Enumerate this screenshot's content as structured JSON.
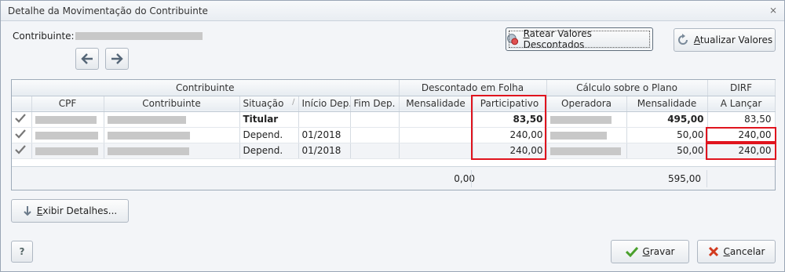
{
  "window": {
    "title": "Detalhe da Movimentação do Contribuinte",
    "close_glyph": "⨯"
  },
  "header": {
    "contribuinte_label": "Contribuinte:"
  },
  "toolbar": {
    "ratear_label": "Ratear Valores Descontados",
    "ratear_underline": "R",
    "atualizar_label": "Atualizar Valores",
    "atualizar_underline": "A"
  },
  "grid": {
    "groups": [
      {
        "label": "Contribuinte"
      },
      {
        "label": "Descontado em Folha"
      },
      {
        "label": "Cálculo sobre o Plano"
      },
      {
        "label": "DIRF"
      }
    ],
    "columns": [
      "CPF",
      "Contribuinte",
      "Situação",
      "Início Dep.",
      "Fim Dep.",
      "Mensalidade",
      "Participativo",
      "Operadora",
      "Mensalidade",
      "A Lançar"
    ],
    "rows": [
      {
        "situacao": "Titular",
        "inicio": "",
        "fim": "",
        "mens_desc": "",
        "participativo": "83,50",
        "mens_plano": "495,00",
        "a_lancar": "83,50"
      },
      {
        "situacao": "Depend.",
        "inicio": "01/2018",
        "fim": "",
        "mens_desc": "",
        "participativo": "240,00",
        "mens_plano": "50,00",
        "a_lancar": "240,00"
      },
      {
        "situacao": "Depend.",
        "inicio": "01/2018",
        "fim": "",
        "mens_desc": "",
        "participativo": "240,00",
        "mens_plano": "50,00",
        "a_lancar": "240,00"
      }
    ],
    "totals": {
      "desc_mensalidade": "0,00",
      "plano_mensalidade": "595,00"
    }
  },
  "actions": {
    "exibir_label": "Exibir Detalhes...",
    "exibir_underline": "E",
    "gravar_label": "Gravar",
    "gravar_underline": "G",
    "cancelar_label": "Cancelar",
    "cancelar_underline": "C",
    "help_label": "?"
  },
  "colors": {
    "highlight": "#e0141e",
    "border": "#9eabb9",
    "header_bg": "#e7ecf1"
  }
}
